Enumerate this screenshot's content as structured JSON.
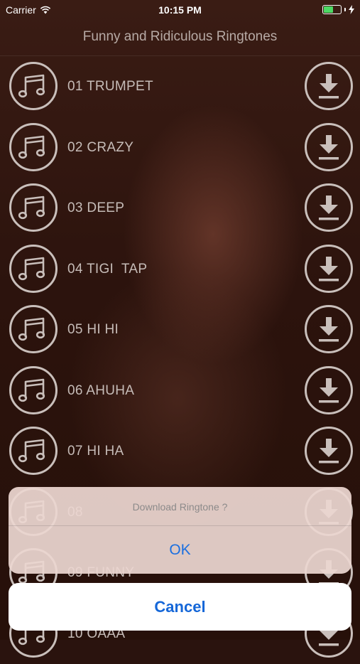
{
  "status_bar": {
    "carrier": "Carrier",
    "time": "10:15 PM",
    "battery_level": 0.55,
    "battery_color": "#4cd964"
  },
  "nav": {
    "title": "Funny and Ridiculous Ringtones"
  },
  "ringtones": [
    {
      "label": "01 TRUMPET"
    },
    {
      "label": "02 CRAZY"
    },
    {
      "label": "03 DEEP"
    },
    {
      "label": "04 TIGI  TAP"
    },
    {
      "label": "05 HI HI"
    },
    {
      "label": "06 AHUHA"
    },
    {
      "label": "07 HI HA"
    },
    {
      "label": "08"
    },
    {
      "label": "09 FUNNY"
    },
    {
      "label": "10 OAAA"
    }
  ],
  "icons": {
    "row_leading": "music-note-icon",
    "row_trailing": "download-icon"
  },
  "action_sheet": {
    "title": "Download Ringtone ?",
    "ok_label": "OK",
    "cancel_label": "Cancel"
  },
  "colors": {
    "accent": "#1b6fe0",
    "background": "#2c130d"
  }
}
